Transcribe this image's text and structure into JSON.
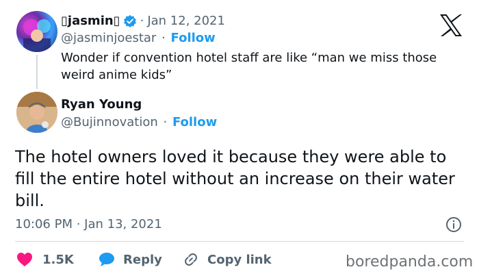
{
  "parent_tweet": {
    "author_name": "▯jasmin▯",
    "verified_icon": "verified-badge-icon",
    "date": "Jan 12, 2021",
    "handle": "@jasminjoestar",
    "follow_label": "Follow",
    "text": "Wonder if convention hotel staff are like “man we miss those weird anime kids”"
  },
  "reply_tweet": {
    "author_name": "Ryan Young",
    "handle": "@Bujinnovation",
    "follow_label": "Follow",
    "text": "The hotel owners loved it because they were able to fill the entire hotel without an increase on their water bill.",
    "timestamp": "10:06 PM · Jan 13, 2021"
  },
  "actions": {
    "like_count": "1.5K",
    "reply_label": "Reply",
    "copy_link_label": "Copy link"
  },
  "separator": "·",
  "icons": {
    "platform": "x-logo-icon",
    "info": "info-icon",
    "like": "heart-icon",
    "reply": "speech-bubble-icon",
    "link": "link-icon"
  },
  "colors": {
    "accent": "#1d9bf0",
    "heart": "#f91880",
    "muted": "#536471",
    "text": "#0f1419"
  },
  "watermark": "boredpanda.com"
}
